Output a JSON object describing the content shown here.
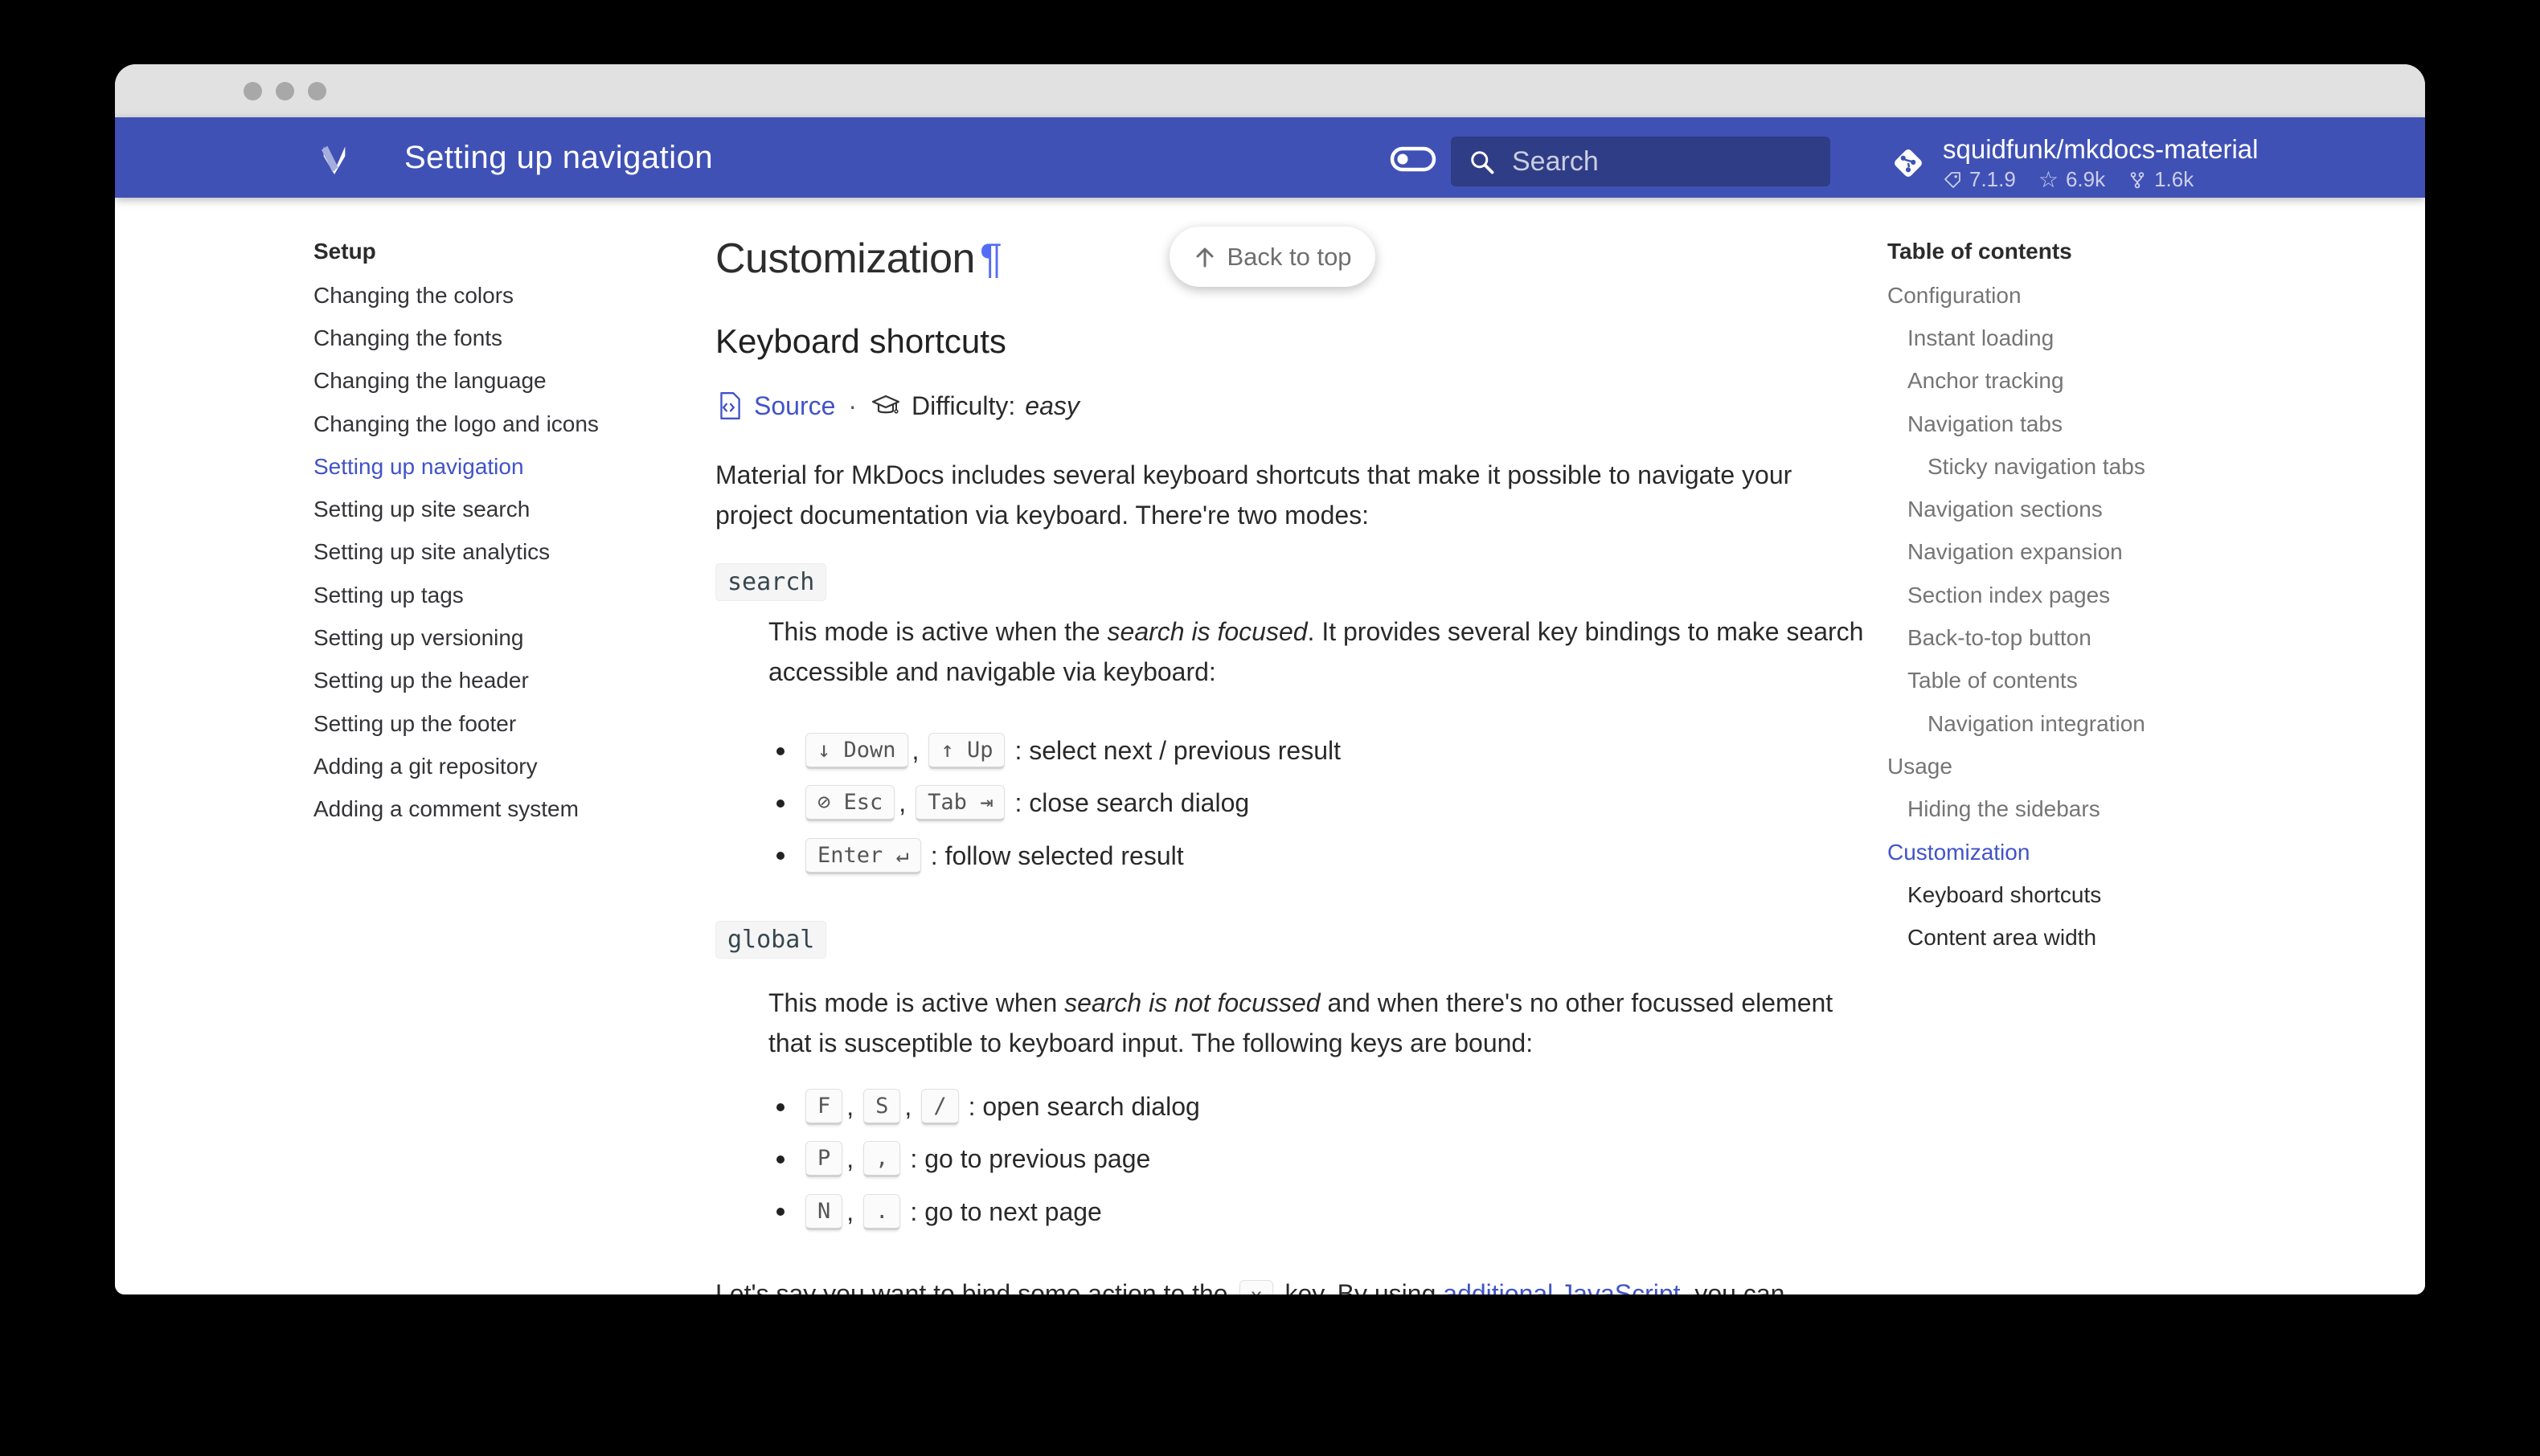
{
  "header": {
    "title": "Setting up navigation",
    "search_placeholder": "Search",
    "repo_name": "squidfunk/mkdocs-material",
    "repo_version": "7.1.9",
    "repo_stars": "6.9k",
    "repo_forks": "1.6k"
  },
  "sidebar": {
    "title": "Setup",
    "items": [
      {
        "label": "Changing the colors"
      },
      {
        "label": "Changing the fonts"
      },
      {
        "label": "Changing the language"
      },
      {
        "label": "Changing the logo and icons"
      },
      {
        "label": "Setting up navigation",
        "state": "active"
      },
      {
        "label": "Setting up site search"
      },
      {
        "label": "Setting up site analytics"
      },
      {
        "label": "Setting up tags"
      },
      {
        "label": "Setting up versioning"
      },
      {
        "label": "Setting up the header"
      },
      {
        "label": "Setting up the footer"
      },
      {
        "label": "Adding a git repository"
      },
      {
        "label": "Adding a comment system"
      }
    ]
  },
  "toc": {
    "title": "Table of contents",
    "items": [
      {
        "label": "Configuration",
        "level": 1
      },
      {
        "label": "Instant loading",
        "level": 2
      },
      {
        "label": "Anchor tracking",
        "level": 2
      },
      {
        "label": "Navigation tabs",
        "level": 2
      },
      {
        "label": "Sticky navigation tabs",
        "level": 3
      },
      {
        "label": "Navigation sections",
        "level": 2
      },
      {
        "label": "Navigation expansion",
        "level": 2
      },
      {
        "label": "Section index pages",
        "level": 2
      },
      {
        "label": "Back-to-top button",
        "level": 2
      },
      {
        "label": "Table of contents",
        "level": 2
      },
      {
        "label": "Navigation integration",
        "level": 3
      },
      {
        "label": "Usage",
        "level": 1
      },
      {
        "label": "Hiding the sidebars",
        "level": 2
      },
      {
        "label": "Customization",
        "level": 1,
        "state": "active"
      },
      {
        "label": "Keyboard shortcuts",
        "level": 2,
        "state": "dark"
      },
      {
        "label": "Content area width",
        "level": 2,
        "state": "dark"
      }
    ]
  },
  "main": {
    "back_to_top": "Back to top",
    "h1": "Customization",
    "pilcrow": "¶",
    "h2": "Keyboard shortcuts",
    "source_label": "Source",
    "dot_separator": "·",
    "difficulty_label": "Difficulty:",
    "difficulty_value": "easy",
    "intro": "Material for MkDocs includes several keyboard shortcuts that make it possible to navigate your project documentation via keyboard. There're two modes:",
    "mode1": {
      "name": "search",
      "desc_pre": "This mode is active when the ",
      "desc_italic": "search is focused",
      "desc_post": ". It provides several key bindings to make search accessible and navigable via keyboard:",
      "items": [
        {
          "keys": [
            "↓ Down",
            "↑ Up"
          ],
          "desc": ": select next / previous result"
        },
        {
          "keys": [
            "⊘ Esc",
            "Tab ⇥"
          ],
          "desc": ": close search dialog"
        },
        {
          "keys": [
            "Enter ↵"
          ],
          "desc": ": follow selected result"
        }
      ]
    },
    "mode2": {
      "name": "global",
      "desc_pre": "This mode is active when ",
      "desc_italic": "search is not focussed",
      "desc_post": " and when there's no other focussed element that is susceptible to keyboard input. The following keys are bound:",
      "items": [
        {
          "keys": [
            "F",
            "S",
            "/"
          ],
          "desc": ": open search dialog"
        },
        {
          "keys": [
            "P",
            ","
          ],
          "desc": ": go to previous page"
        },
        {
          "keys": [
            "N",
            "."
          ],
          "desc": ": go to next page"
        }
      ]
    },
    "footer": {
      "pre": "Let's say you want to bind some action to the ",
      "key": "x",
      "mid": " key. By using ",
      "link_label": "additional JavaScript",
      "post": ", you can"
    }
  },
  "colors": {
    "header_background": "#4051b5",
    "link_accent": "#4153c8",
    "pilcrow": "#536cf5",
    "toc_muted": "#757575",
    "body_text": "#2b2b2b",
    "titlebar": "#e1e1e1"
  }
}
